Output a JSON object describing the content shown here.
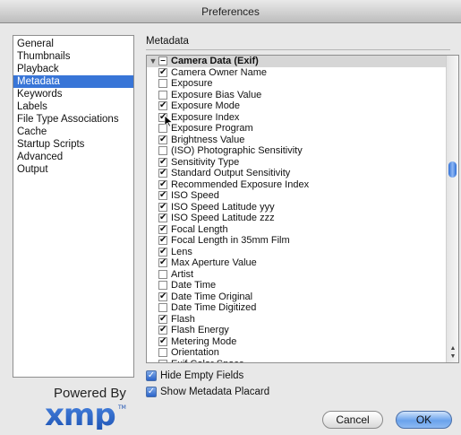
{
  "window": {
    "title": "Preferences"
  },
  "sidebar": {
    "items": [
      {
        "label": "General"
      },
      {
        "label": "Thumbnails"
      },
      {
        "label": "Playback"
      },
      {
        "label": "Metadata",
        "selected": true
      },
      {
        "label": "Keywords"
      },
      {
        "label": "Labels"
      },
      {
        "label": "File Type Associations"
      },
      {
        "label": "Cache"
      },
      {
        "label": "Startup Scripts"
      },
      {
        "label": "Advanced"
      },
      {
        "label": "Output"
      }
    ]
  },
  "panel": {
    "title": "Metadata",
    "group": {
      "label": "Camera Data (Exif)",
      "expanded": true
    },
    "fields": [
      {
        "label": "Camera Owner Name",
        "checked": true
      },
      {
        "label": "Exposure",
        "checked": false
      },
      {
        "label": "Exposure Bias Value",
        "checked": false
      },
      {
        "label": "Exposure Mode",
        "checked": true
      },
      {
        "label": "Exposure Index",
        "checked": true
      },
      {
        "label": "Exposure Program",
        "checked": false
      },
      {
        "label": "Brightness Value",
        "checked": true
      },
      {
        "label": "(ISO) Photographic Sensitivity",
        "checked": false
      },
      {
        "label": "Sensitivity Type",
        "checked": true
      },
      {
        "label": "Standard Output Sensitivity",
        "checked": true
      },
      {
        "label": "Recommended Exposure Index",
        "checked": true
      },
      {
        "label": "ISO Speed",
        "checked": true
      },
      {
        "label": "ISO Speed Latitude yyy",
        "checked": true
      },
      {
        "label": "ISO Speed Latitude zzz",
        "checked": true
      },
      {
        "label": "Focal Length",
        "checked": true
      },
      {
        "label": "Focal Length in 35mm Film",
        "checked": true
      },
      {
        "label": "Lens",
        "checked": true
      },
      {
        "label": "Max Aperture Value",
        "checked": true
      },
      {
        "label": "Artist",
        "checked": false
      },
      {
        "label": "Date Time",
        "checked": false
      },
      {
        "label": "Date Time Original",
        "checked": true
      },
      {
        "label": "Date Time Digitized",
        "checked": false
      },
      {
        "label": "Flash",
        "checked": true
      },
      {
        "label": "Flash Energy",
        "checked": true
      },
      {
        "label": "Metering Mode",
        "checked": true
      },
      {
        "label": "Orientation",
        "checked": false
      },
      {
        "label": "Exif Color Space",
        "checked": false
      }
    ],
    "options": [
      {
        "label": "Hide Empty Fields",
        "checked": true
      },
      {
        "label": "Show Metadata Placard",
        "checked": true
      }
    ]
  },
  "branding": {
    "powered_by": "Powered By",
    "logo_text": "xmp",
    "logo_mark": "TM"
  },
  "buttons": {
    "cancel": "Cancel",
    "ok": "OK"
  },
  "colors": {
    "selection": "#3875d7",
    "ok_button": "#6aa2ec",
    "logo_blue": "#1f5fc4"
  }
}
